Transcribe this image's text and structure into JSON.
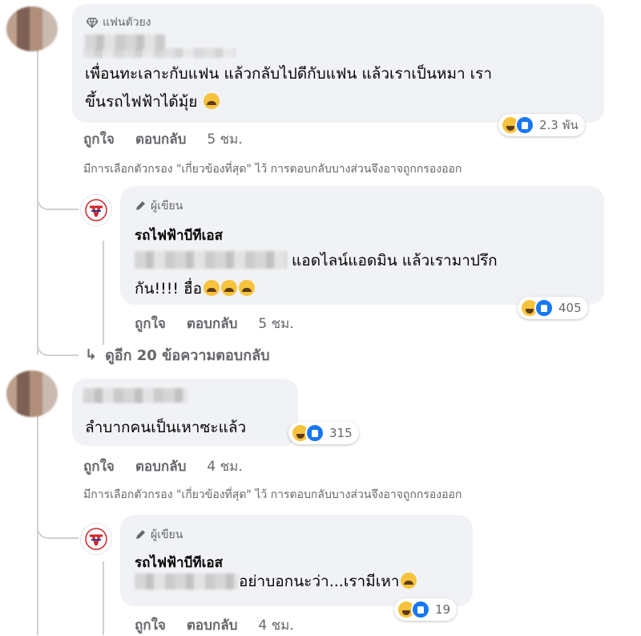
{
  "comment1": {
    "badge": "แฟนตัวยง",
    "text_line1": "เพื่อนทะเลาะกับแฟน แล้วกลับไปดีกับแฟน แล้วเราเป็นหมา เรา",
    "text_line2": "ขึ้นรถไฟฟ้าได้มุ้ย",
    "reaction_count": "2.3 พัน",
    "like_label": "ถูกใจ",
    "reply_label": "ตอบกลับ",
    "time": "5 ชม.",
    "filter_note": "มีการเลือกตัวกรอง \"เกี่ยวข้องที่สุด\" ไว้ การตอบกลับบางส่วนจึงอาจถูกกรองออก",
    "reply": {
      "author_badge": "ผู้เขียน",
      "author": "รถไฟฟ้าบีทีเอส",
      "text_line1": "แอดไลน์แอดมิน แล้วเรามาปรึก",
      "text_line2": "กัน!!!! ฮื่อ",
      "reaction_count": "405",
      "like_label": "ถูกใจ",
      "reply_label": "ตอบกลับ",
      "time": "5 ชม."
    },
    "more_replies": "ดูอีก 20 ข้อความตอบกลับ"
  },
  "comment2": {
    "text": "ลำบากคนเป็นเหาซะแล้ว",
    "reaction_count": "315",
    "like_label": "ถูกใจ",
    "reply_label": "ตอบกลับ",
    "time": "4 ชม.",
    "filter_note": "มีการเลือกตัวกรอง \"เกี่ยวข้องที่สุด\" ไว้ การตอบกลับบางส่วนจึงอาจถูกกรองออก",
    "reply": {
      "author_badge": "ผู้เขียน",
      "author": "รถไฟฟ้าบีทีเอส",
      "text": "อย่าบอกนะว่า...เรามีเหา",
      "reaction_count": "19",
      "like_label": "ถูกใจ",
      "reply_label": "ตอบกลับ",
      "time": "4 ชม."
    }
  },
  "icons": {
    "badge_icon": "diamond-icon",
    "author_icon": "pen-icon",
    "more_icon": "reply-arrow-icon"
  },
  "colors": {
    "bubble": "#f0f2f5",
    "secondary_text": "#65676b",
    "like_blue": "#1877f2",
    "haha_yellow": "#f7c33c",
    "bts_red": "#d2232a"
  }
}
